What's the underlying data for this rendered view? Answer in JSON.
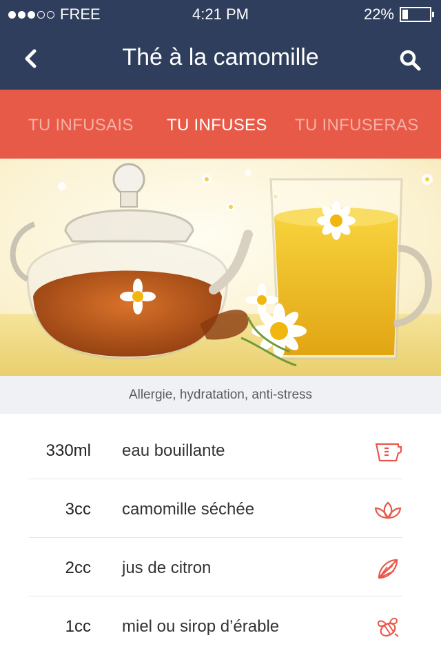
{
  "status_bar": {
    "carrier": "FREE",
    "time": "4:21  PM",
    "battery": "22%",
    "battery_level": 0.22,
    "signal_bars_filled": 3,
    "signal_bars_total": 5
  },
  "nav": {
    "title": "Thé à la camomille",
    "back_icon": "chevron-left-icon",
    "search_icon": "search-icon"
  },
  "tabs": [
    {
      "label": "TU INFUSAIS",
      "active": false
    },
    {
      "label": "TU INFUSES",
      "active": true
    },
    {
      "label": "TU INFUSERAS",
      "active": false
    }
  ],
  "hero": {
    "image": "chamomile tea teapot and glass cup with daisies"
  },
  "caption": "Allergie, hydratation, anti-stress",
  "ingredients": [
    {
      "qty": "330ml",
      "name": "eau bouillante",
      "icon": "measuring-cup-icon"
    },
    {
      "qty": "3cc",
      "name": "camomille séchée",
      "icon": "leaves-icon"
    },
    {
      "qty": "2cc",
      "name": "jus de citron",
      "icon": "lemon-slice-icon"
    },
    {
      "qty": "1cc",
      "name": "miel ou sirop d’érable",
      "icon": "bee-icon"
    }
  ],
  "colors": {
    "navy": "#2e3e5c",
    "accent": "#e85a48",
    "tab_inactive": "#f4b1a7",
    "caption_bg": "#f0f1f5"
  }
}
